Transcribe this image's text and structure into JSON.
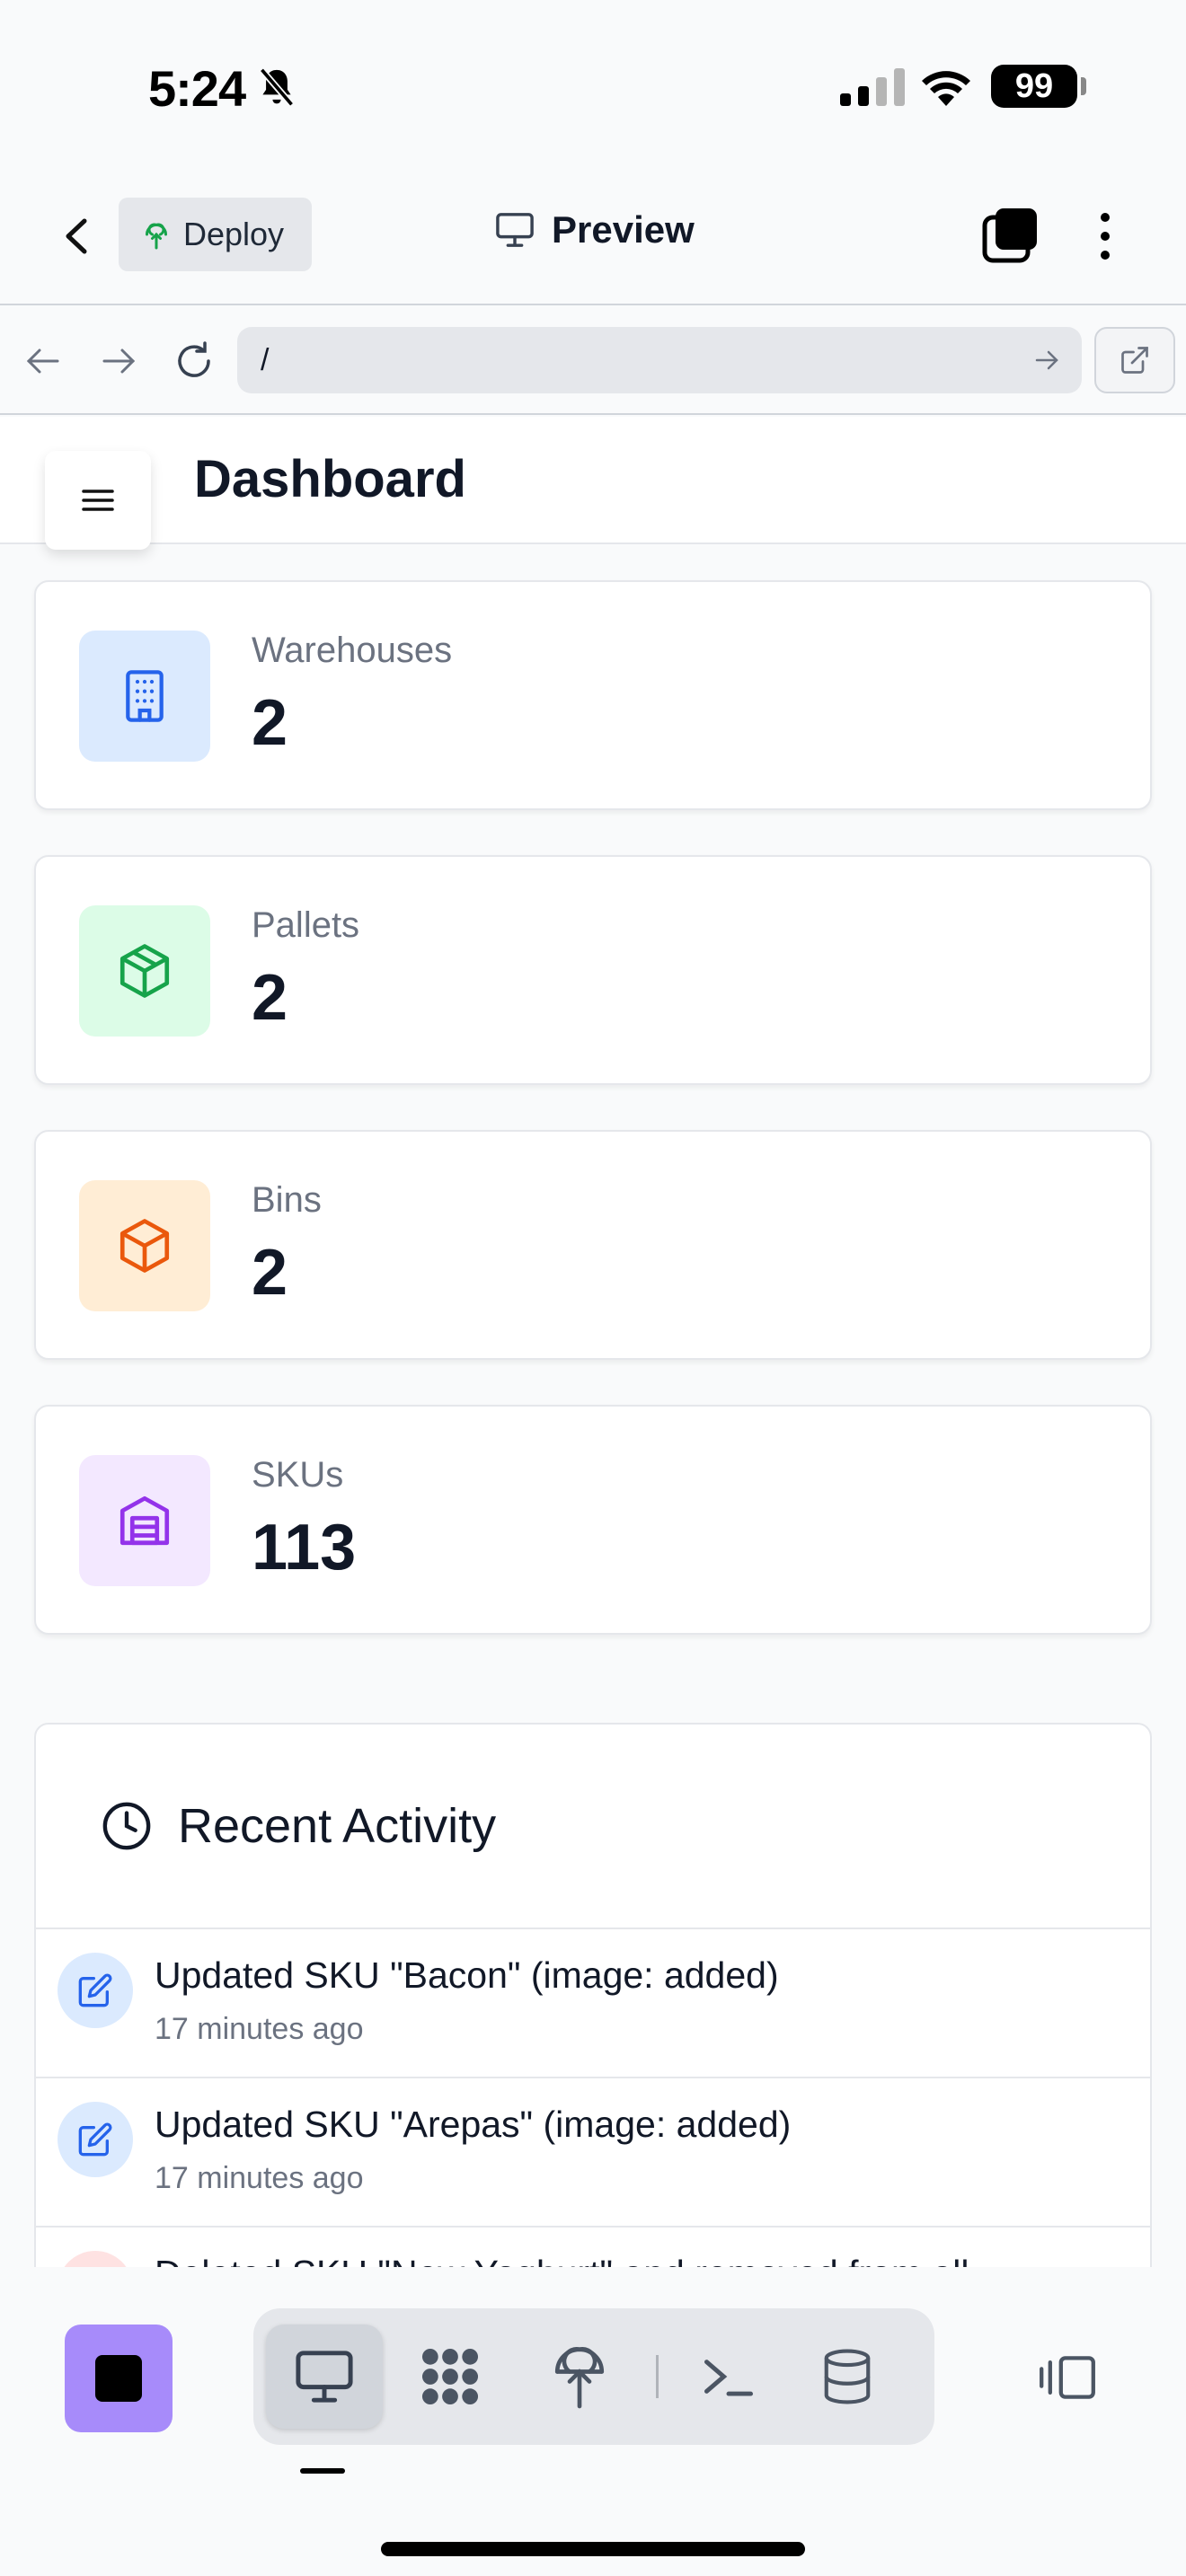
{
  "status_bar": {
    "time": "5:24",
    "battery": "99"
  },
  "header": {
    "deploy_label": "Deploy",
    "preview_label": "Preview"
  },
  "url_bar": {
    "url": "/"
  },
  "page": {
    "title": "Dashboard"
  },
  "stats": [
    {
      "label": "Warehouses",
      "value": "2",
      "icon": "building-icon",
      "color": "#2563eb",
      "bg": "#dbeafe"
    },
    {
      "label": "Pallets",
      "value": "2",
      "icon": "package-icon",
      "color": "#16a34a",
      "bg": "#dcfce7"
    },
    {
      "label": "Bins",
      "value": "2",
      "icon": "box-icon",
      "color": "#ea580c",
      "bg": "#ffedd5"
    },
    {
      "label": "SKUs",
      "value": "113",
      "icon": "warehouse-icon",
      "color": "#9333ea",
      "bg": "#f3e8ff"
    }
  ],
  "activity": {
    "title": "Recent Activity",
    "items": [
      {
        "text": "Updated SKU \"Bacon\" (image: added)",
        "time": "17 minutes ago",
        "icon": "edit-icon"
      },
      {
        "text": "Updated SKU \"Arepas\" (image: added)",
        "time": "17 minutes ago",
        "icon": "edit-icon"
      },
      {
        "text": "Deleted SKU \"New Yoghurt\" and removed from all",
        "time": "",
        "icon": "delete-icon"
      }
    ]
  },
  "colors": {
    "accent": "#a78bfa",
    "edit": "#2563eb",
    "delete": "#dc2626"
  }
}
